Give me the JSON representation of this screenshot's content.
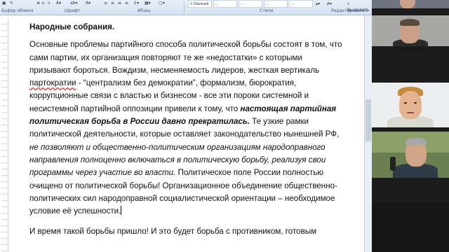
{
  "ribbon": {
    "group_clipboard": "Буфер обмена",
    "group_font": "Шрифт",
    "group_paragraph": "Абзац",
    "group_styles": "Стили",
    "group_editing": "Редактирование",
    "style_normal": "1 Обычный",
    "style_item2": "...",
    "style_item3": "...",
    "change_styles": "Изменить стили",
    "select_label": "Выделить"
  },
  "document": {
    "heading": "Народные собрания.",
    "p1_s1": "Основные проблемы  партийного способа политической борьбы состоят в том, что сами партии, их организация повторяют те же «недостатки» с которыми призывают бороться. Вождизм, несменяемость лидеров, жесткая вертикаль ",
    "p1_spell": "партократии",
    "p1_s2": " - “централизм без демократии”, формализм, бюрократия, коррупционные связи с властью и бизнесом - все эти пороки системной и несистемной партийной оппозиции привели к тому, что ",
    "p1_bi": "настоящая партийная политическая борьба в России давно прекратилась.",
    "p1_s3": " Те узкие рамки политической деятельности, которые оставляет законодательство нынешней РФ, ",
    "p1_it": "не позволяют и общественно-политическим организациям народоправного направления полноценно включаться в политическую борьбу, реализуя свои программы через участие во власти.",
    "p1_s4": "  Политическое поле России полностью очищено от политической борьбы! Организационное объединение  общественно-политических сил народоправной социалистической ориентации – необходимое условие её успешности.",
    "p2": "И время такой борьбы пришло! И это будет борьба с противником, готовым"
  },
  "colors": {
    "ribbon_bg": "#dce6f2",
    "spellcheck": "#d21f1f",
    "video_bg": "#1b1b1b"
  },
  "video_tiles": [
    {
      "icon": "participant-video"
    },
    {
      "icon": "participant-video"
    },
    {
      "icon": "participant-video"
    },
    {
      "icon": "participant-video"
    },
    {
      "icon": "participant-video"
    }
  ]
}
